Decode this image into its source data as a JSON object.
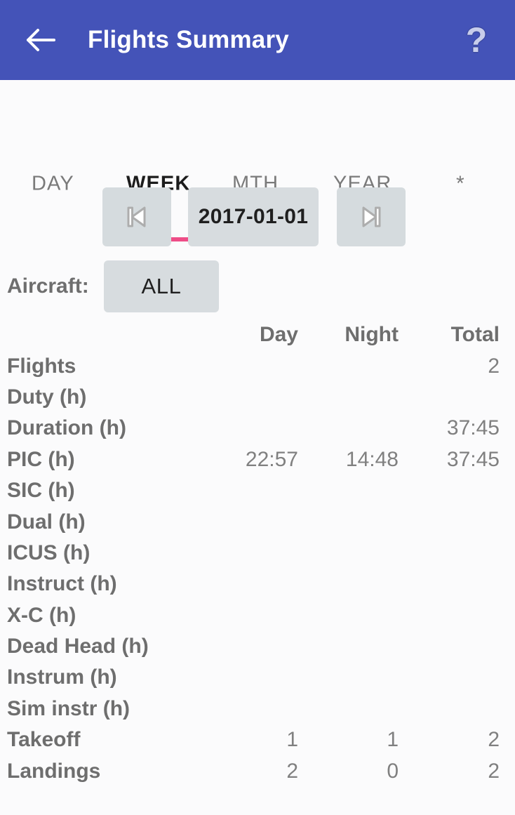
{
  "appbar": {
    "back_icon": "back-arrow-icon",
    "title": "Flights Summary",
    "help_icon": "question-mark-icon",
    "help_glyph": "?",
    "bg_color": "#4453b8",
    "title_color": "#ffffff"
  },
  "tabs": {
    "items": [
      {
        "label": "DAY",
        "active": false
      },
      {
        "label": "WEEK",
        "active": true
      },
      {
        "label": "MTH",
        "active": false
      },
      {
        "label": "YEAR",
        "active": false
      },
      {
        "label": "*",
        "active": false
      }
    ],
    "indicator_color": "#ee4d87",
    "active_index": 1
  },
  "navigation": {
    "prev_icon": "skip-previous-icon",
    "next_icon": "skip-next-icon",
    "date_value": "2017-01-01"
  },
  "filter": {
    "aircraft_label": "Aircraft:",
    "aircraft_value": "ALL"
  },
  "summary": {
    "columns": [
      "",
      "Day",
      "Night",
      "Total"
    ],
    "rows": [
      {
        "label": "Flights",
        "day": "",
        "night": "",
        "total": "2"
      },
      {
        "label": "Duty (h)",
        "day": "",
        "night": "",
        "total": ""
      },
      {
        "label": "Duration (h)",
        "day": "",
        "night": "",
        "total": "37:45"
      },
      {
        "label": "PIC (h)",
        "day": "22:57",
        "night": "14:48",
        "total": "37:45"
      },
      {
        "label": "SIC (h)",
        "day": "",
        "night": "",
        "total": ""
      },
      {
        "label": "Dual (h)",
        "day": "",
        "night": "",
        "total": ""
      },
      {
        "label": "ICUS (h)",
        "day": "",
        "night": "",
        "total": ""
      },
      {
        "label": "Instruct (h)",
        "day": "",
        "night": "",
        "total": ""
      },
      {
        "label": "X-C (h)",
        "day": "",
        "night": "",
        "total": ""
      },
      {
        "label": "Dead Head (h)",
        "day": "",
        "night": "",
        "total": ""
      },
      {
        "label": "Instrum (h)",
        "day": "",
        "night": "",
        "total": ""
      },
      {
        "label": "Sim instr (h)",
        "day": "",
        "night": "",
        "total": ""
      },
      {
        "label": "Takeoff",
        "day": "1",
        "night": "1",
        "total": "2"
      },
      {
        "label": "Landings",
        "day": "2",
        "night": "0",
        "total": "2"
      }
    ]
  },
  "colors": {
    "background": "#fbfbfc",
    "label_text": "#6e6e6e",
    "value_text": "#808080",
    "button_bg": "#d7dcdf",
    "accent_pink": "#ee4d87",
    "header_blue": "#4453b8"
  }
}
